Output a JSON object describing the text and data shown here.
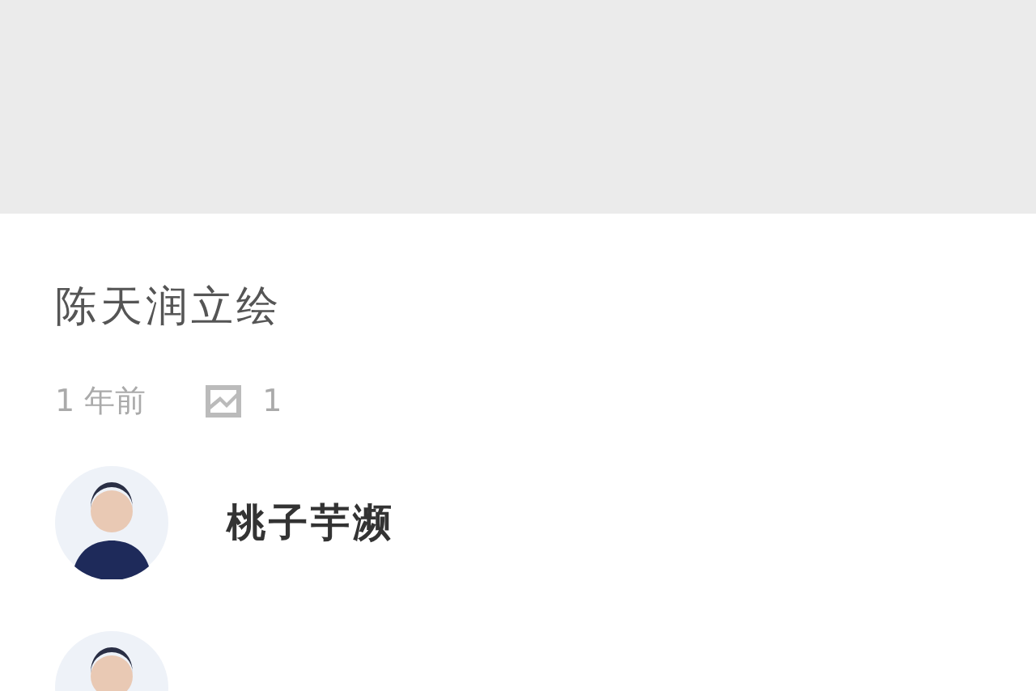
{
  "title": "陈天润立绘",
  "meta": {
    "time": "1 年前",
    "count": "1"
  },
  "users": [
    {
      "kind": "named",
      "name": "桃子芋濒"
    },
    {
      "kind": "avatar_only"
    }
  ]
}
